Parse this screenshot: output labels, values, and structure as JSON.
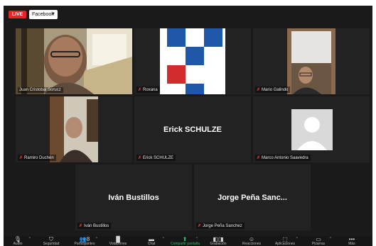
{
  "topbar": {
    "live_badge": "LIVE",
    "stream_target": "Facebook"
  },
  "participants": [
    {
      "name": "Juan Cristobal Sorucz",
      "display": "",
      "active": true
    },
    {
      "name": "Roxana",
      "display": ""
    },
    {
      "name": "Mario Galindo",
      "display": ""
    },
    {
      "name": "Ramiro Duchén",
      "display": ""
    },
    {
      "name": "Erick SCHULZE",
      "display": "Erick SCHULZE"
    },
    {
      "name": "Marco Antonio Saavedra",
      "display": ""
    },
    {
      "name": "Iván Bustillos",
      "display": "Iván Bustillos"
    },
    {
      "name": "Jorge Peña Sanchez",
      "display": "Jorge Peña Sanc..."
    }
  ],
  "toolbar": {
    "items": [
      {
        "icon": "microphone-icon",
        "label": "Audio"
      },
      {
        "icon": "shield-icon",
        "label": "Seguridad"
      },
      {
        "icon": "participants-icon",
        "label": "Participantes",
        "count": "8"
      },
      {
        "icon": "polls-icon",
        "label": "Votaciones"
      },
      {
        "icon": "chat-icon",
        "label": "Chat"
      },
      {
        "icon": "share-screen-icon",
        "label": "Compartir pantalla"
      },
      {
        "icon": "record-icon",
        "label": "Grabación"
      },
      {
        "icon": "reactions-icon",
        "label": "Reacciones"
      },
      {
        "icon": "apps-icon",
        "label": "Aplicaciones"
      },
      {
        "icon": "whiteboard-icon",
        "label": "Pizarras"
      },
      {
        "icon": "more-icon",
        "label": "Más"
      }
    ]
  },
  "colors": {
    "active_border": "#c9d46a",
    "mic_muted": "#e03b3b",
    "share_green": "#2bc06a"
  }
}
